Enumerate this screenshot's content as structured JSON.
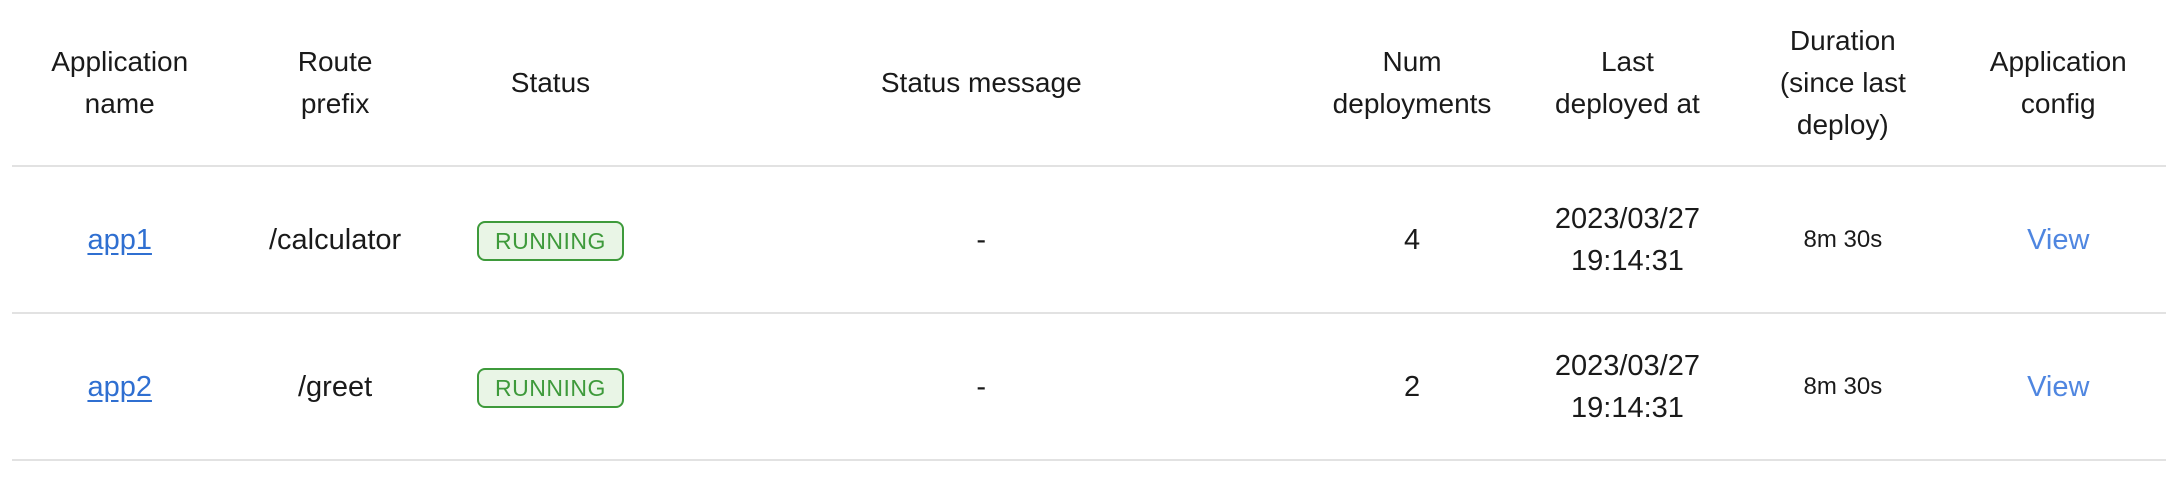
{
  "table": {
    "headers": {
      "app_name": [
        "Application",
        "name"
      ],
      "route_prefix": [
        "Route",
        "prefix"
      ],
      "status": [
        "Status"
      ],
      "status_message": [
        "Status message"
      ],
      "num_deployments": [
        "Num",
        "deployments"
      ],
      "last_deployed_at": [
        "Last",
        "deployed at"
      ],
      "duration": [
        "Duration",
        "(since last",
        "deploy)"
      ],
      "app_config": [
        "Application",
        "config"
      ]
    },
    "rows": [
      {
        "name": "app1",
        "route_prefix": "/calculator",
        "status": "RUNNING",
        "status_message": "-",
        "num_deployments": "4",
        "last_deployed_date": "2023/03/27",
        "last_deployed_time": "19:14:31",
        "duration": "8m 30s",
        "config_link": "View"
      },
      {
        "name": "app2",
        "route_prefix": "/greet",
        "status": "RUNNING",
        "status_message": "-",
        "num_deployments": "2",
        "last_deployed_date": "2023/03/27",
        "last_deployed_time": "19:14:31",
        "duration": "8m 30s",
        "config_link": "View"
      }
    ]
  },
  "colors": {
    "link": "#2f6fd1",
    "view_link": "#4f86e0",
    "status_running_border": "#3e9a3b",
    "status_running_bg": "#e9f5e6",
    "divider": "#e2e2e2"
  }
}
